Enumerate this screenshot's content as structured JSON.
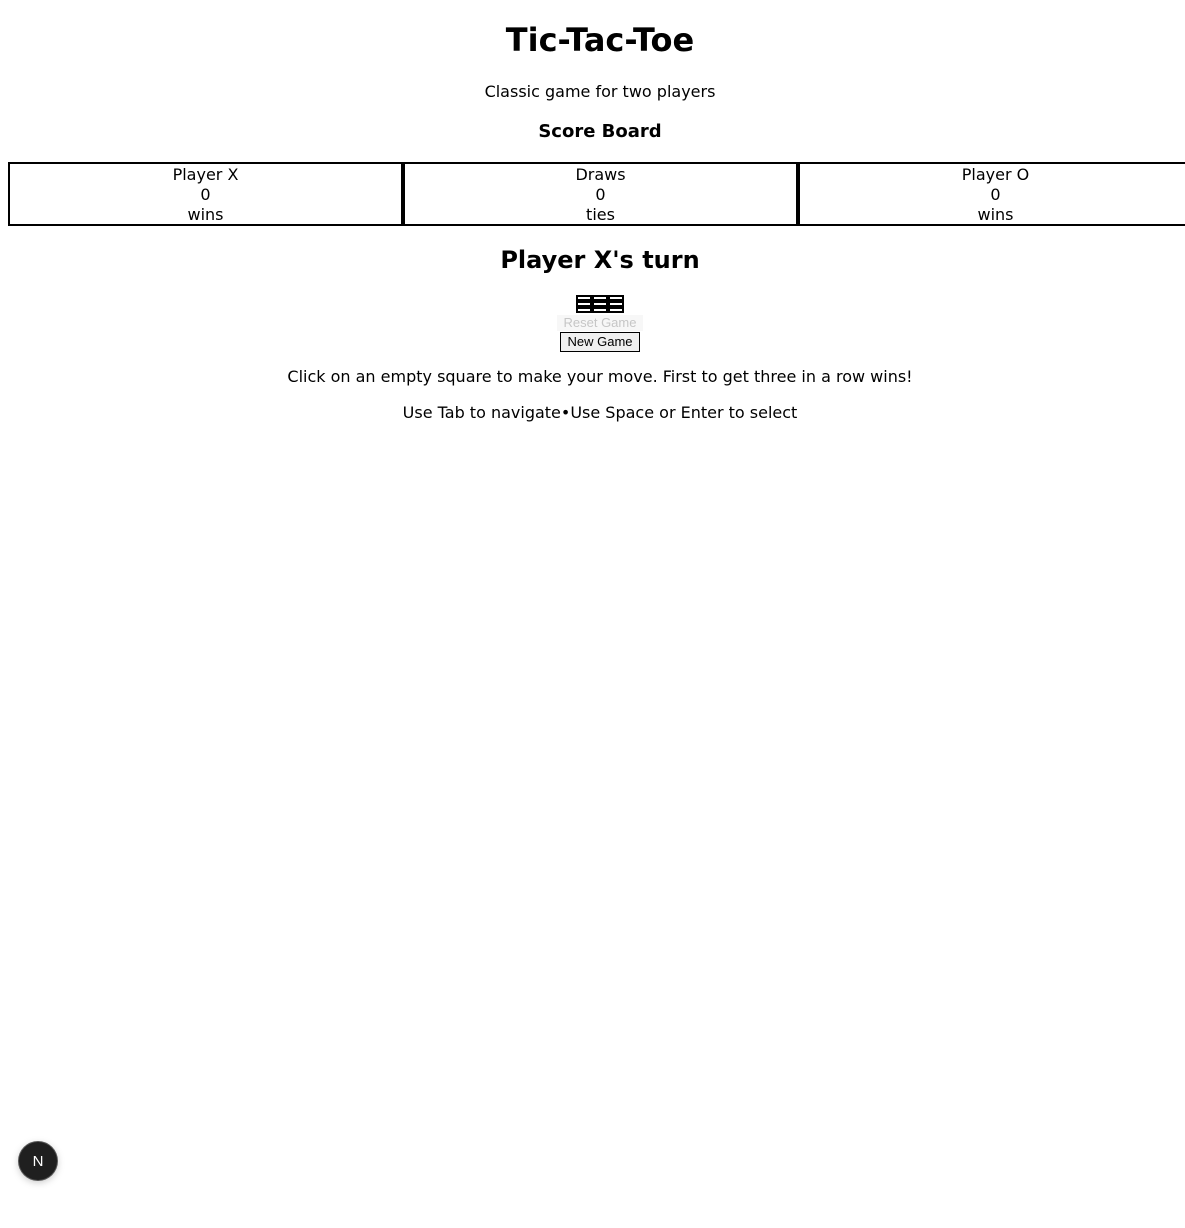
{
  "header": {
    "title": "Tic-Tac-Toe",
    "subtitle": "Classic game for two players"
  },
  "scoreboard": {
    "heading": "Score Board",
    "cards": [
      {
        "label": "Player X",
        "value": "0",
        "unit": "wins"
      },
      {
        "label": "Draws",
        "value": "0",
        "unit": "ties"
      },
      {
        "label": "Player O",
        "value": "0",
        "unit": "wins"
      }
    ]
  },
  "game": {
    "status": "Player X's turn",
    "board": [
      "",
      "",
      "",
      "",
      "",
      "",
      "",
      "",
      ""
    ],
    "reset_label": "Reset Game",
    "new_game_label": "New Game"
  },
  "help": {
    "instructions": "Click on an empty square to make your move. First to get three in a row wins!",
    "keyboard": "Use Tab to navigate•Use Space or Enter to select"
  },
  "dev_badge": {
    "letter": "N",
    "icon": "nextjs-logo-icon"
  }
}
